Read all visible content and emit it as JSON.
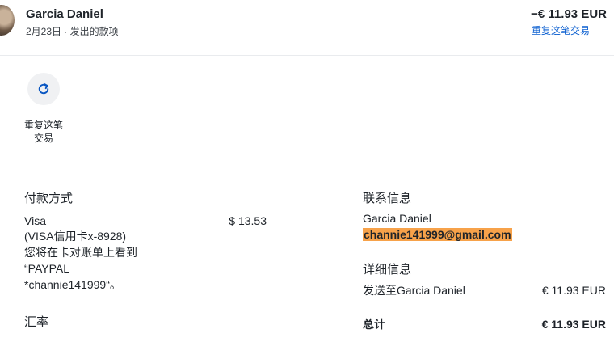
{
  "header": {
    "name": "Garcia Daniel",
    "subtitle": "2月23日 · 发出的款项",
    "amount": "−€ 11.93 EUR",
    "repeat_link": "重复这笔交易"
  },
  "actions": {
    "repeat_label_line1": "重复这笔",
    "repeat_label_line2": "交易",
    "repeat_icon": "refresh-icon"
  },
  "payment": {
    "title": "付款方式",
    "card": "Visa",
    "card_detail": "(VISA信用卡x-8928)",
    "note_line1": "您将在卡对账单上看到",
    "note_line2": "“PAYPAL",
    "note_line3": "*channie141999“。",
    "amount": "$ 13.53"
  },
  "exchange": {
    "title": "汇率"
  },
  "contact": {
    "title": "联系信息",
    "name": "Garcia Daniel",
    "email": "channie141999@gmail.com"
  },
  "details": {
    "title": "详细信息",
    "sent_to_label": "发送至Garcia Daniel",
    "sent_to_amount": "€ 11.93 EUR",
    "total_label": "总计",
    "total_amount": "€ 11.93 EUR"
  }
}
